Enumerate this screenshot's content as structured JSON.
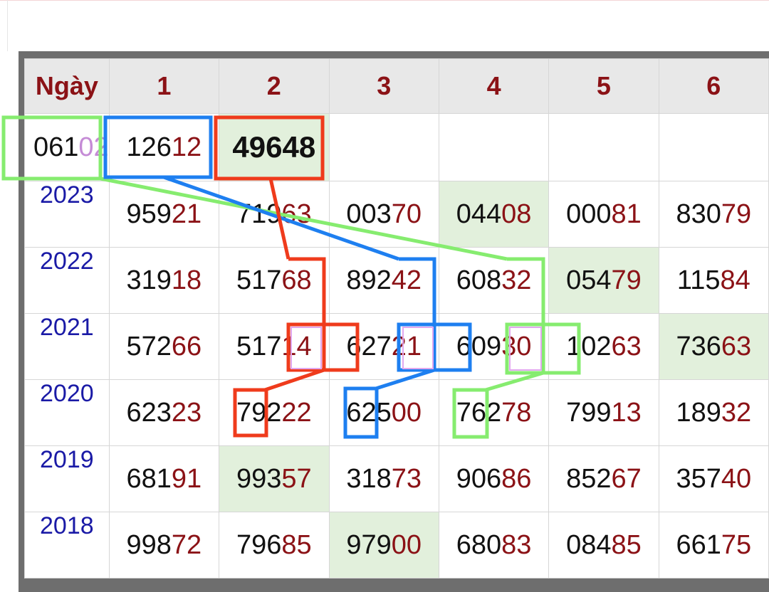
{
  "header": {
    "day_label": "Ngày",
    "columns": [
      "1",
      "2",
      "3",
      "4",
      "5",
      "6"
    ]
  },
  "first_row": {
    "date_head": "061",
    "date_tail": "02",
    "cells": [
      {
        "head": "126",
        "tail": "12"
      },
      {
        "head": "49648",
        "tail": "",
        "bold": true
      },
      {
        "head": "",
        "tail": ""
      },
      {
        "head": "",
        "tail": ""
      },
      {
        "head": "",
        "tail": ""
      },
      {
        "head": "",
        "tail": ""
      }
    ]
  },
  "rows": [
    {
      "year": "2023",
      "cells": [
        {
          "head": "959",
          "tail": "21"
        },
        {
          "head": "719",
          "tail": "63"
        },
        {
          "head": "003",
          "tail": "70"
        },
        {
          "head": "044",
          "tail": "08",
          "hl": true
        },
        {
          "head": "000",
          "tail": "81"
        },
        {
          "head": "830",
          "tail": "79"
        }
      ]
    },
    {
      "year": "2022",
      "cells": [
        {
          "head": "319",
          "tail": "18"
        },
        {
          "head": "517",
          "tail": "68"
        },
        {
          "head": "892",
          "tail": "42"
        },
        {
          "head": "608",
          "tail": "32"
        },
        {
          "head": "054",
          "tail": "79",
          "hl": true
        },
        {
          "head": "115",
          "tail": "84"
        }
      ]
    },
    {
      "year": "2021",
      "cells": [
        {
          "head": "572",
          "tail": "66"
        },
        {
          "head": "517",
          "tail": "14"
        },
        {
          "head": "627",
          "tail": "21"
        },
        {
          "head": "609",
          "tail": "30"
        },
        {
          "head": "102",
          "tail": "63"
        },
        {
          "head": "736",
          "tail": "63",
          "hl": true
        }
      ]
    },
    {
      "year": "2020",
      "cells": [
        {
          "head": "623",
          "tail": "23"
        },
        {
          "head": "792",
          "tail": "22"
        },
        {
          "head": "625",
          "tail": "00"
        },
        {
          "head": "762",
          "tail": "78"
        },
        {
          "head": "799",
          "tail": "13"
        },
        {
          "head": "189",
          "tail": "32"
        }
      ]
    },
    {
      "year": "2019",
      "cells": [
        {
          "head": "681",
          "tail": "91"
        },
        {
          "head": "993",
          "tail": "57",
          "hl": true
        },
        {
          "head": "318",
          "tail": "73"
        },
        {
          "head": "906",
          "tail": "86"
        },
        {
          "head": "852",
          "tail": "67"
        },
        {
          "head": "357",
          "tail": "40"
        }
      ]
    },
    {
      "year": "2018",
      "cells": [
        {
          "head": "998",
          "tail": "72"
        },
        {
          "head": "796",
          "tail": "85"
        },
        {
          "head": "979",
          "tail": "00",
          "hl": true
        },
        {
          "head": "680",
          "tail": "83"
        },
        {
          "head": "084",
          "tail": "85"
        },
        {
          "head": "661",
          "tail": "75"
        }
      ]
    }
  ],
  "colors": {
    "header_text": "#8b1216",
    "year_text": "#1a1aa6",
    "tail_text": "#8b1216",
    "highlight_bg": "#e2f0dc",
    "annotation_green": "#86ec6f",
    "annotation_blue": "#1e7ff0",
    "annotation_red": "#ef3b1c",
    "annotation_pink": "#e1a7ee"
  }
}
